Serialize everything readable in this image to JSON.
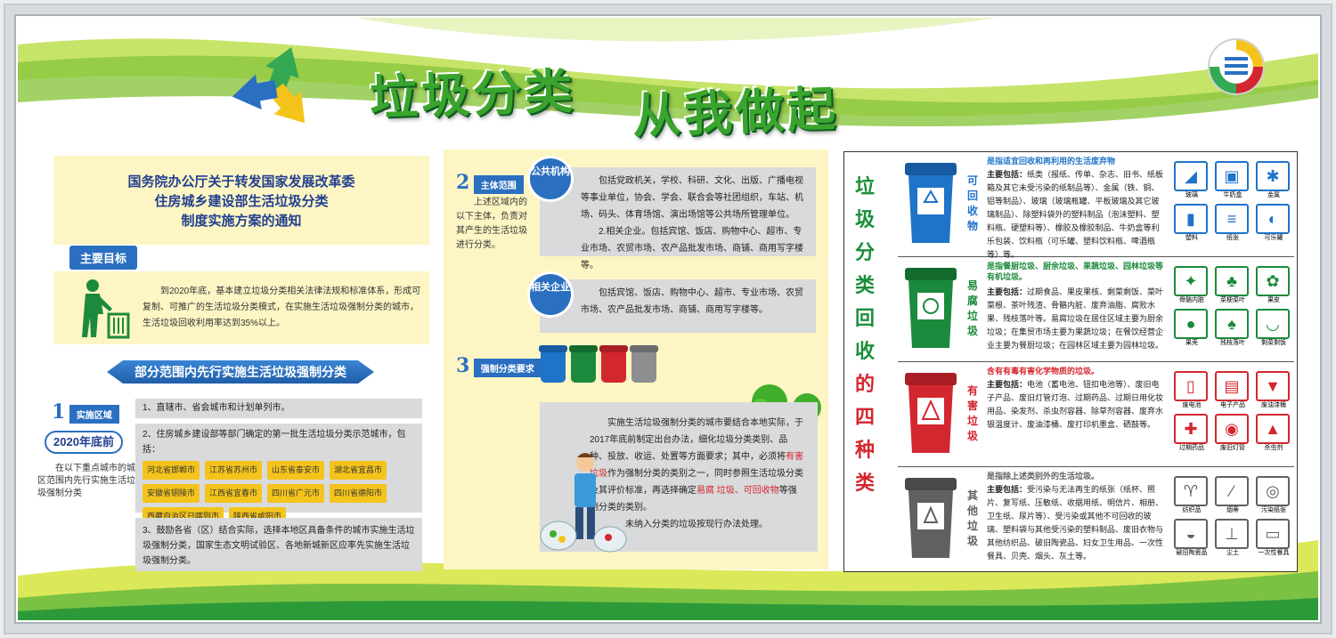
{
  "header": {
    "title1": "垃圾分类",
    "title2": "从我做起"
  },
  "notice": {
    "line1": "国务院办公厅关于转发国家发展改革委",
    "line2": "住房城乡建设部生活垃圾分类",
    "line3": "制度实施方案的通知"
  },
  "goal": {
    "tag": "主要目标",
    "text": "到2020年底，基本建立垃圾分类相关法律法规和标准体系，形成可复制、可推广的生活垃圾分类模式，在实施生活垃圾强制分类的城市，生活垃圾回收利用率达到35%以上。"
  },
  "section_banner": "部分范围内先行实施生活垃圾强制分类",
  "area": {
    "num": "1",
    "tag": "实施区域",
    "deadline": "2020年底前",
    "desc": "在以下重点城市的城区范围内先行实施生活垃圾强制分类",
    "row1": "1、直辖市、省会城市和计划单列市。",
    "row2": "2、住房城乡建设部等部门确定的第一批生活垃圾分类示范城市，包括：",
    "cities": [
      "河北省邯郸市",
      "江苏省苏州市",
      "山东省泰安市",
      "湖北省宜昌市",
      "安徽省铜陵市",
      "江西省宜春市",
      "四川省广元市",
      "四川省德阳市",
      "西藏自治区日喀则市",
      "陕西省咸阳市"
    ],
    "row3": "3、鼓励各省（区）结合实际，选择本地区具备条件的城市实施生活垃圾强制分类，国家生态文明试验区、各地新城新区应率先实施生活垃圾强制分类。"
  },
  "scope": {
    "num": "2",
    "tag": "主体范围",
    "desc": "上述区域内的以下主体，负责对其产生的生活垃圾进行分类。",
    "public_label": "公共机构",
    "public_text": "包括党政机关，学校、科研、文化、出版、广播电视等事业单位，协会、学会、联合会等社团组织，车站、机场、码头、体育场馆、演出场馆等公共场所管理单位。",
    "public_text2": "2.相关企业。包括宾馆、饭店、购物中心、超市、专业市场、农贸市场、农产品批发市场、商铺、商用写字楼等。",
    "related_label": "相关企业",
    "related_text": "包括宾馆、饭店、购物中心、超市、专业市场、农贸市场、农产品批发市场、商铺、商用写字楼等。"
  },
  "requirement": {
    "num": "3",
    "tag": "强制分类要求",
    "text_a": "实施生活垃圾强制分类的城市要结合本地实际，于2017年底前制定出台办法，细化垃圾分类类别、品种、投放、收运、处置等方面要求；其中，必须将",
    "text_red1": "有害垃圾",
    "text_b": "作为强制分类的类别之一，同时参照生活垃圾分类及其评价标准，再选择确定",
    "text_red2": "易腐 垃圾、可回收物",
    "text_c": "等强制分类的类别。",
    "text_d": "未纳入分类的垃圾按现行办法处理。"
  },
  "right": {
    "vertical_title": [
      "垃",
      "圾",
      "分",
      "类",
      "回",
      "收",
      "的",
      "四",
      "种",
      "类"
    ],
    "categories": [
      {
        "name": "可回收物",
        "color": "#1f73c9",
        "head": "是指适宜回收和再利用的生活废弃物",
        "label_main": "主要包括：",
        "text": "纸类（报纸、传单、杂志、旧书、纸板箱及其它未受污染的纸制品等）、金属（铁、铜、铝等制品）、玻璃（玻璃瓶罐、平板玻璃及其它玻璃制品）、除塑料袋外的塑料制品（泡沫塑料、塑料瓶、硬塑料等）、橡胶及橡胶制品、牛奶盒等利乐包装、饮料瓶（可乐罐、塑料饮料瓶、啤酒瓶等）等。",
        "icons": [
          "玻璃",
          "牛奶盒",
          "金属",
          "塑料",
          "纸张",
          "可乐罐"
        ]
      },
      {
        "name": "易腐垃圾",
        "color": "#1c8a3c",
        "head": "是指餐厨垃圾、厨余垃圾、果蔬垃圾、园林垃圾等有机垃圾。",
        "label_main": "主要包括：",
        "text": "过期食品、果皮果核、剩菜剩饭、菜叶菜根、茶叶残渣、骨骼内脏、废弃油脂、腐败水果、残枝落叶等。易腐垃圾在居住区域主要为厨余垃圾；在集贸市场主要为果蔬垃圾；在餐饮经营企业主要为餐厨垃圾；在园林区域主要为园林垃圾。",
        "icons": [
          "骨骼内脏",
          "菜梗菜叶",
          "果皮",
          "果壳",
          "残枝落叶",
          "剩菜剩饭"
        ]
      },
      {
        "name": "有害垃圾",
        "color": "#d3272f",
        "head": "含有有毒有害化学物质的垃圾。",
        "label_main": "主要包括：",
        "text": "电池（蓄电池、钮扣电池等）、废旧电子产品、废旧灯管灯泡、过期药品、过期日用化妆用品、染发剂、杀虫剂容器、除草剂容器、废弃水银温度计、废油漆桶、废打印机墨盒、硒鼓等。",
        "icons": [
          "废电池",
          "电子产品",
          "废油漆桶",
          "过期药品",
          "废旧灯管",
          "杀虫剂"
        ]
      },
      {
        "name": "其他垃圾",
        "color": "#5f6062",
        "head": "是指除上述类别外的生活垃圾。",
        "label_main": "主要包括：",
        "text": "受污染与无法再生的纸张（纸杯、照片、复写纸、压敏纸、收据用纸、明信片、相册、卫生纸、尿片等）、受污染或其他不可回收的玻璃、塑料袋与其他受污染的塑料制品、废旧衣物与其他纺织品、破旧陶瓷品、妇女卫生用品、一次性餐具、贝壳、烟头、灰土等。",
        "icons": [
          "纺织品",
          "烟蒂",
          "污染纸张",
          "破旧陶瓷品",
          "尘土",
          "一次性餐具"
        ]
      }
    ]
  },
  "colors": {
    "green": "#3aa52d",
    "blue": "#2a6fc0",
    "yellow_bg": "#fdf6c4",
    "red": "#d3272f"
  }
}
